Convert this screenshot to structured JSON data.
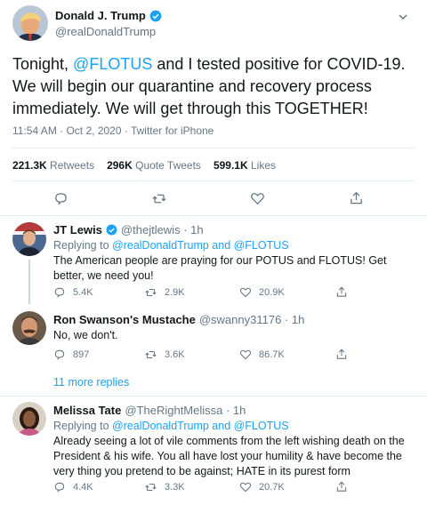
{
  "main_tweet": {
    "author_name": "Donald J. Trump",
    "handle": "@realDonaldTrump",
    "text_pre": "Tonight, ",
    "mention": "@FLOTUS",
    "text_post": " and I tested positive for COVID-19. We will begin our quarantine and recovery process immediately. We will get through this TOGETHER!",
    "timestamp": "11:54 AM · Oct 2, 2020 · Twitter for iPhone",
    "stats": {
      "retweets_count": "221.3K",
      "retweets_label": "Retweets",
      "quotes_count": "296K",
      "quotes_label": "Quote Tweets",
      "likes_count": "599.1K",
      "likes_label": "Likes"
    }
  },
  "replies": [
    {
      "name": "JT Lewis",
      "handle": "@thejtlewis · 1h",
      "replying_prefix": "Replying to ",
      "replying_mentions": "@realDonaldTrump and @FLOTUS",
      "text": "The American people are praying for our POTUS and FLOTUS! Get better, we need you!",
      "reply_count": "5.4K",
      "retweet_count": "2.9K",
      "like_count": "20.9K"
    },
    {
      "name": "Ron Swanson's Mustache",
      "handle": "@swanny31176 · 1h",
      "text": "No, we don't.",
      "reply_count": "897",
      "retweet_count": "3.6K",
      "like_count": "86.7K"
    },
    {
      "name": "Melissa Tate",
      "handle": "@TheRightMelissa · 1h",
      "replying_prefix": "Replying to ",
      "replying_mentions": "@realDonaldTrump and @FLOTUS",
      "text": "Already seeing a lot of vile comments from the left wishing death on the President & his wife. You all have lost your humility & have become the very thing you pretend to be against; HATE in its purest form",
      "reply_count": "4.4K",
      "retweet_count": "3.3K",
      "like_count": "20.7K"
    }
  ],
  "more_replies_label": "11 more replies",
  "colors": {
    "accent": "#1da1f2",
    "muted": "#657786",
    "divider": "#e6ecf0"
  }
}
